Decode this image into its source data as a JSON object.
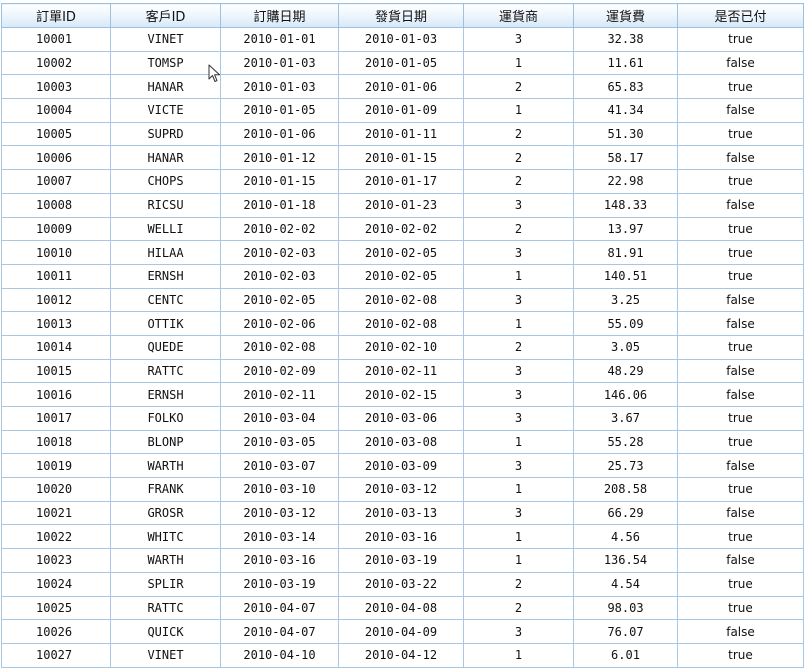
{
  "columns": [
    "訂單ID",
    "客戶ID",
    "訂購日期",
    "發貨日期",
    "運貨商",
    "運貨費",
    "是否已付"
  ],
  "rows": [
    [
      "10001",
      "VINET",
      "2010-01-01",
      "2010-01-03",
      "3",
      "32.38",
      "true"
    ],
    [
      "10002",
      "TOMSP",
      "2010-01-03",
      "2010-01-05",
      "1",
      "11.61",
      "false"
    ],
    [
      "10003",
      "HANAR",
      "2010-01-03",
      "2010-01-06",
      "2",
      "65.83",
      "true"
    ],
    [
      "10004",
      "VICTE",
      "2010-01-05",
      "2010-01-09",
      "1",
      "41.34",
      "false"
    ],
    [
      "10005",
      "SUPRD",
      "2010-01-06",
      "2010-01-11",
      "2",
      "51.30",
      "true"
    ],
    [
      "10006",
      "HANAR",
      "2010-01-12",
      "2010-01-15",
      "2",
      "58.17",
      "false"
    ],
    [
      "10007",
      "CHOPS",
      "2010-01-15",
      "2010-01-17",
      "2",
      "22.98",
      "true"
    ],
    [
      "10008",
      "RICSU",
      "2010-01-18",
      "2010-01-23",
      "3",
      "148.33",
      "false"
    ],
    [
      "10009",
      "WELLI",
      "2010-02-02",
      "2010-02-02",
      "2",
      "13.97",
      "true"
    ],
    [
      "10010",
      "HILAA",
      "2010-02-03",
      "2010-02-05",
      "3",
      "81.91",
      "true"
    ],
    [
      "10011",
      "ERNSH",
      "2010-02-03",
      "2010-02-05",
      "1",
      "140.51",
      "true"
    ],
    [
      "10012",
      "CENTC",
      "2010-02-05",
      "2010-02-08",
      "3",
      "3.25",
      "false"
    ],
    [
      "10013",
      "OTTIK",
      "2010-02-06",
      "2010-02-08",
      "1",
      "55.09",
      "false"
    ],
    [
      "10014",
      "QUEDE",
      "2010-02-08",
      "2010-02-10",
      "2",
      "3.05",
      "true"
    ],
    [
      "10015",
      "RATTC",
      "2010-02-09",
      "2010-02-11",
      "3",
      "48.29",
      "false"
    ],
    [
      "10016",
      "ERNSH",
      "2010-02-11",
      "2010-02-15",
      "3",
      "146.06",
      "false"
    ],
    [
      "10017",
      "FOLKO",
      "2010-03-04",
      "2010-03-06",
      "3",
      "3.67",
      "true"
    ],
    [
      "10018",
      "BLONP",
      "2010-03-05",
      "2010-03-08",
      "1",
      "55.28",
      "true"
    ],
    [
      "10019",
      "WARTH",
      "2010-03-07",
      "2010-03-09",
      "3",
      "25.73",
      "false"
    ],
    [
      "10020",
      "FRANK",
      "2010-03-10",
      "2010-03-12",
      "1",
      "208.58",
      "true"
    ],
    [
      "10021",
      "GROSR",
      "2010-03-12",
      "2010-03-13",
      "3",
      "66.29",
      "false"
    ],
    [
      "10022",
      "WHITC",
      "2010-03-14",
      "2010-03-16",
      "1",
      "4.56",
      "true"
    ],
    [
      "10023",
      "WARTH",
      "2010-03-16",
      "2010-03-19",
      "1",
      "136.54",
      "false"
    ],
    [
      "10024",
      "SPLIR",
      "2010-03-19",
      "2010-03-22",
      "2",
      "4.54",
      "true"
    ],
    [
      "10025",
      "RATTC",
      "2010-04-07",
      "2010-04-08",
      "2",
      "98.03",
      "true"
    ],
    [
      "10026",
      "QUICK",
      "2010-04-07",
      "2010-04-09",
      "3",
      "76.07",
      "false"
    ],
    [
      "10027",
      "VINET",
      "2010-04-10",
      "2010-04-12",
      "1",
      "6.01",
      "true"
    ]
  ],
  "colors": {
    "grid_line": "#a8c7e2",
    "header_top": "#ffffff",
    "header_bottom": "#d6e8f7",
    "text": "#111111"
  },
  "icons": {
    "cursor": "mouse-pointer-icon"
  }
}
